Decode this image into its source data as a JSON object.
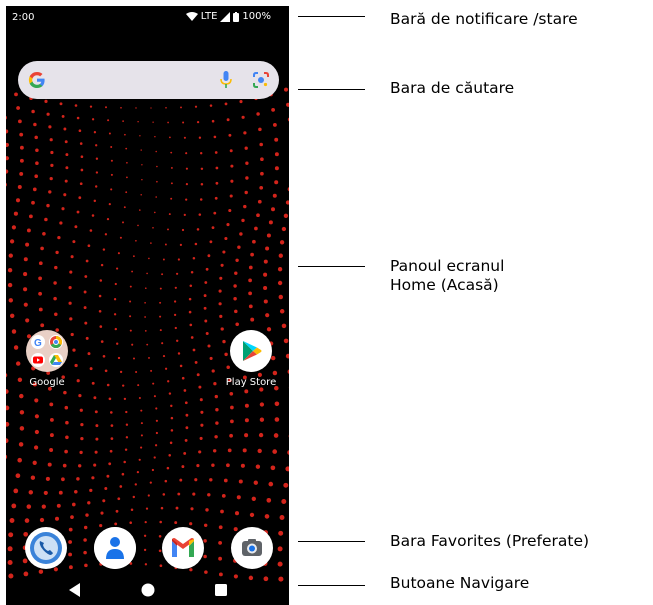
{
  "status_bar": {
    "time": "2:00",
    "network": "LTE",
    "battery": "100%"
  },
  "search_bar": {
    "logo": "google-g-icon",
    "mic": "mic-icon",
    "lens": "lens-icon"
  },
  "apps": {
    "folder": {
      "label": "Google"
    },
    "play_store": {
      "label": "Play Store"
    }
  },
  "dock": [
    "phone-icon",
    "contacts-icon",
    "gmail-icon",
    "camera-icon"
  ],
  "nav": [
    "back-icon",
    "home-icon",
    "recents-icon"
  ],
  "callouts": {
    "notification_bar": "Bară de notificare /stare",
    "search_bar": "Bara de căutare",
    "home_panel_line1": "Panoul ecranul",
    "home_panel_line2": "Home (Acasă)",
    "favorites_bar": "Bara Favorites (Preferate)",
    "nav_buttons": "Butoane Navigare"
  },
  "colors": {
    "wallpaper": "#000000",
    "dots": "#d3241b",
    "search_bg": "#e6e3ea"
  }
}
